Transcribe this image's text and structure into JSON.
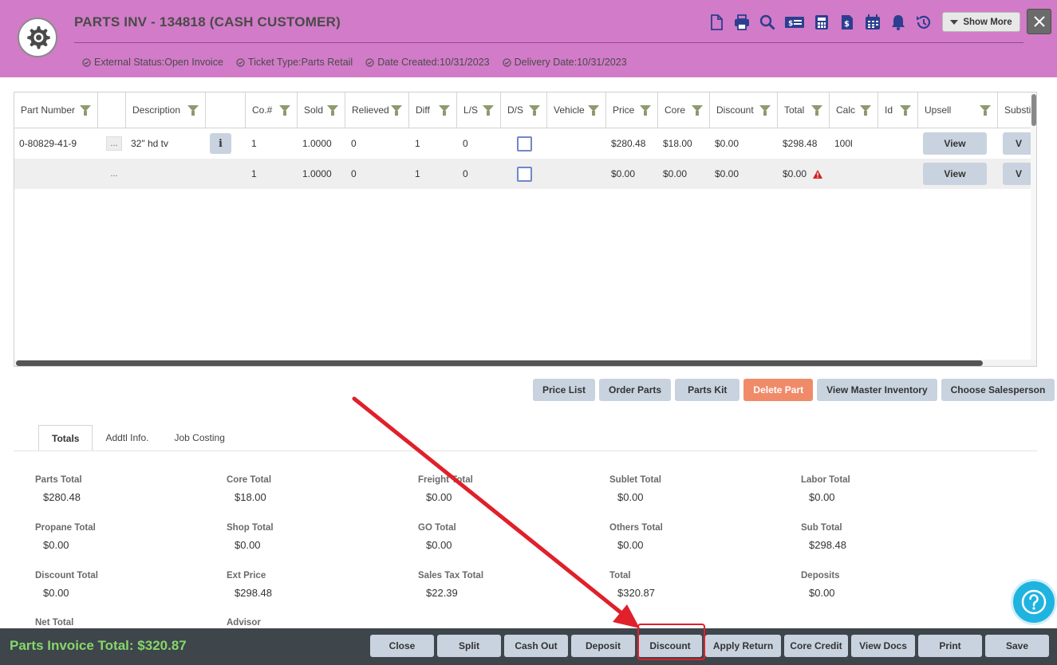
{
  "header": {
    "title": "PARTS INV - 134818 (CASH CUSTOMER)",
    "status": [
      {
        "text": "External Status:Open Invoice"
      },
      {
        "text": "Ticket Type:Parts Retail"
      },
      {
        "text": "Date Created:10/31/2023"
      },
      {
        "text": "Delivery Date:10/31/2023"
      }
    ],
    "toolbar_icons": [
      "document-icon",
      "printer-icon",
      "search-icon",
      "money-icon",
      "calculator-icon",
      "invoice-dollar-icon",
      "calendar-icon",
      "bell-icon",
      "history-icon"
    ],
    "show_more_label": "Show More"
  },
  "grid": {
    "columns": [
      "Part Number",
      "",
      "Description",
      "",
      "Co.#",
      "Sold",
      "Relieved",
      "Diff",
      "L/S",
      "D/S",
      "Vehicle",
      "Price",
      "Core",
      "Discount",
      "Total",
      "Calc",
      "Id",
      "Upsell",
      "Substi"
    ],
    "rows": [
      {
        "part_number": "0-80829-41-9",
        "dots": "...",
        "description": "32\" hd tv",
        "co": "1",
        "sold": "1.0000",
        "relieved": "0",
        "diff": "1",
        "ls": "0",
        "price": "$280.48",
        "core": "$18.00",
        "discount": "$0.00",
        "total": "$298.48",
        "calc": "100l",
        "upsell_label": "View",
        "substi_label": "V"
      },
      {
        "part_number": "",
        "dots": "...",
        "description": "",
        "co": "1",
        "sold": "1.0000",
        "relieved": "0",
        "diff": "1",
        "ls": "0",
        "price": "$0.00",
        "core": "$0.00",
        "discount": "$0.00",
        "total": "$0.00",
        "calc": "",
        "upsell_label": "View",
        "substi_label": "V"
      }
    ]
  },
  "actions": [
    "Price List",
    "Order Parts",
    "Parts Kit",
    "Delete Part",
    "View Master Inventory",
    "Choose Salesperson"
  ],
  "tabs": [
    "Totals",
    "Addtl Info.",
    "Job Costing"
  ],
  "totals": [
    {
      "label": "Parts Total",
      "value": "$280.48"
    },
    {
      "label": "Core Total",
      "value": "$18.00"
    },
    {
      "label": "Freight Total",
      "value": "$0.00"
    },
    {
      "label": "Sublet Total",
      "value": "$0.00"
    },
    {
      "label": "Labor Total",
      "value": "$0.00"
    },
    {
      "label": "Propane Total",
      "value": "$0.00"
    },
    {
      "label": "Shop Total",
      "value": "$0.00"
    },
    {
      "label": "GO Total",
      "value": "$0.00"
    },
    {
      "label": "Others Total",
      "value": "$0.00"
    },
    {
      "label": "Sub Total",
      "value": "$298.48"
    },
    {
      "label": "Discount Total",
      "value": "$0.00"
    },
    {
      "label": "Ext Price",
      "value": "$298.48"
    },
    {
      "label": "Sales Tax Total",
      "value": "$22.39"
    },
    {
      "label": "Total",
      "value": "$320.87"
    },
    {
      "label": "Deposits",
      "value": "$0.00"
    },
    {
      "label": "Net Total",
      "value": ""
    },
    {
      "label": "Advisor",
      "value": ""
    }
  ],
  "footer": {
    "total_text": "Parts Invoice Total: $320.87",
    "buttons": [
      "Close",
      "Split",
      "Cash Out",
      "Deposit",
      "Discount",
      "Apply Return",
      "Core Credit",
      "View Docs",
      "Print",
      "Save"
    ]
  },
  "colors": {
    "header_bg": "#d27bc8",
    "footer_bg": "#3e454b",
    "footer_total": "#86d66b",
    "button_bg": "#c9d3df",
    "danger_bg": "#f08b6a",
    "annotation_red": "#e0202a",
    "help_bg": "#1fb3e0"
  }
}
